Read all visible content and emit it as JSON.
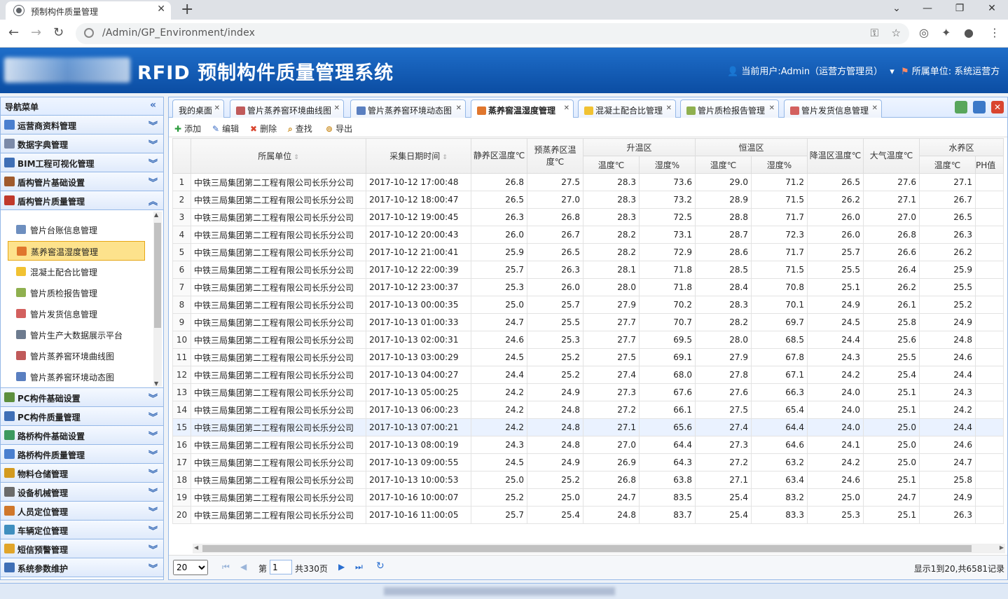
{
  "browser": {
    "tab_title": "预制构件质量管理",
    "url": "/Admin/GP_Environment/index"
  },
  "app": {
    "title": "RFID 预制构件质量管理系统",
    "current_user": "当前用户:Admin（运营方管理员）",
    "unit": "所属单位: 系统运营方"
  },
  "sidebar": {
    "header": "导航菜单",
    "groups_top": [
      {
        "label": "运营商资料管理",
        "color": "#4a7fcf"
      },
      {
        "label": "数据字典管理",
        "color": "#7c8aa8"
      },
      {
        "label": "BIM工程可视化管理",
        "color": "#3f6fb6"
      },
      {
        "label": "盾构管片基础设置",
        "color": "#a05a2c"
      },
      {
        "label": "盾构管片质量管理",
        "color": "#c0392b"
      }
    ],
    "sub_items": [
      {
        "label": "管片台账信息管理",
        "color": "#6e8fbf"
      },
      {
        "label": "蒸养窖温湿度管理",
        "color": "#e0762d"
      },
      {
        "label": "混凝土配合比管理",
        "color": "#f1c232"
      },
      {
        "label": "管片质检报告管理",
        "color": "#8fb04f"
      },
      {
        "label": "管片发货信息管理",
        "color": "#d3605e"
      },
      {
        "label": "管片生产大数据展示平台",
        "color": "#6d7b8f"
      },
      {
        "label": "管片蒸养窖环境曲线图",
        "color": "#c05a5a"
      },
      {
        "label": "管片蒸养窖环境动态图",
        "color": "#5a7fc0"
      }
    ],
    "groups_bottom": [
      {
        "label": "PC构件基础设置",
        "color": "#5d8f3d"
      },
      {
        "label": "PC构件质量管理",
        "color": "#3f6fb6"
      },
      {
        "label": "路桥构件基础设置",
        "color": "#3c9a5f"
      },
      {
        "label": "路桥构件质量管理",
        "color": "#4a7fcf"
      },
      {
        "label": "物料仓储管理",
        "color": "#d39a1f"
      },
      {
        "label": "设备机械管理",
        "color": "#6b6b6b"
      },
      {
        "label": "人员定位管理",
        "color": "#d0772a"
      },
      {
        "label": "车辆定位管理",
        "color": "#3f8fbf"
      },
      {
        "label": "短信预警管理",
        "color": "#e1a52a"
      },
      {
        "label": "系统参数维护",
        "color": "#3f6fb6"
      }
    ]
  },
  "tabs": [
    {
      "label": "我的桌面",
      "color": ""
    },
    {
      "label": "管片蒸养窖环境曲线图",
      "color": "#c05a5a"
    },
    {
      "label": "管片蒸养窖环境动态图",
      "color": "#5a7fc0"
    },
    {
      "label": "蒸养窖温湿度管理",
      "color": "#e0762d"
    },
    {
      "label": "混凝土配合比管理",
      "color": "#f1c232"
    },
    {
      "label": "管片质检报告管理",
      "color": "#8fb04f"
    },
    {
      "label": "管片发货信息管理",
      "color": "#d3605e"
    }
  ],
  "toolbar": {
    "add": "添加",
    "edit": "编辑",
    "delete": "删除",
    "search": "查找",
    "export": "导出"
  },
  "grid": {
    "headers": {
      "unit": "所属单位",
      "time": "采集日期时间",
      "static": "静养区温度℃",
      "pre": "预蒸养区温度℃",
      "rise": "升温区",
      "const": "恒温区",
      "fall": "降温区温度℃",
      "air": "大气温度℃",
      "water": "水养区",
      "temp": "温度℃",
      "hum": "湿度%",
      "ph": "PH值"
    },
    "rows": [
      {
        "n": "1",
        "unit": "中铁三局集团第二工程有限公司长乐分公司",
        "time": "2017-10-12 17:00:48",
        "v": [
          "26.8",
          "27.5",
          "28.3",
          "73.6",
          "29.0",
          "71.2",
          "26.5",
          "27.6",
          "27.1"
        ]
      },
      {
        "n": "2",
        "unit": "中铁三局集团第二工程有限公司长乐分公司",
        "time": "2017-10-12 18:00:47",
        "v": [
          "26.5",
          "27.0",
          "28.3",
          "73.2",
          "28.9",
          "71.5",
          "26.2",
          "27.1",
          "26.7"
        ]
      },
      {
        "n": "3",
        "unit": "中铁三局集团第二工程有限公司长乐分公司",
        "time": "2017-10-12 19:00:45",
        "v": [
          "26.3",
          "26.8",
          "28.3",
          "72.5",
          "28.8",
          "71.7",
          "26.0",
          "27.0",
          "26.5"
        ]
      },
      {
        "n": "4",
        "unit": "中铁三局集团第二工程有限公司长乐分公司",
        "time": "2017-10-12 20:00:43",
        "v": [
          "26.0",
          "26.7",
          "28.2",
          "73.1",
          "28.7",
          "72.3",
          "26.0",
          "26.8",
          "26.3"
        ]
      },
      {
        "n": "5",
        "unit": "中铁三局集团第二工程有限公司长乐分公司",
        "time": "2017-10-12 21:00:41",
        "v": [
          "25.9",
          "26.5",
          "28.2",
          "72.9",
          "28.6",
          "71.7",
          "25.7",
          "26.6",
          "26.2"
        ]
      },
      {
        "n": "6",
        "unit": "中铁三局集团第二工程有限公司长乐分公司",
        "time": "2017-10-12 22:00:39",
        "v": [
          "25.7",
          "26.3",
          "28.1",
          "71.8",
          "28.5",
          "71.5",
          "25.5",
          "26.4",
          "25.9"
        ]
      },
      {
        "n": "7",
        "unit": "中铁三局集团第二工程有限公司长乐分公司",
        "time": "2017-10-12 23:00:37",
        "v": [
          "25.3",
          "26.0",
          "28.0",
          "71.8",
          "28.4",
          "70.8",
          "25.1",
          "26.2",
          "25.5"
        ]
      },
      {
        "n": "8",
        "unit": "中铁三局集团第二工程有限公司长乐分公司",
        "time": "2017-10-13 00:00:35",
        "v": [
          "25.0",
          "25.7",
          "27.9",
          "70.2",
          "28.3",
          "70.1",
          "24.9",
          "26.1",
          "25.2"
        ]
      },
      {
        "n": "9",
        "unit": "中铁三局集团第二工程有限公司长乐分公司",
        "time": "2017-10-13 01:00:33",
        "v": [
          "24.7",
          "25.5",
          "27.7",
          "70.7",
          "28.2",
          "69.7",
          "24.5",
          "25.8",
          "24.9"
        ]
      },
      {
        "n": "10",
        "unit": "中铁三局集团第二工程有限公司长乐分公司",
        "time": "2017-10-13 02:00:31",
        "v": [
          "24.6",
          "25.3",
          "27.7",
          "69.5",
          "28.0",
          "68.5",
          "24.4",
          "25.6",
          "24.8"
        ]
      },
      {
        "n": "11",
        "unit": "中铁三局集团第二工程有限公司长乐分公司",
        "time": "2017-10-13 03:00:29",
        "v": [
          "24.5",
          "25.2",
          "27.5",
          "69.1",
          "27.9",
          "67.8",
          "24.3",
          "25.5",
          "24.6"
        ]
      },
      {
        "n": "12",
        "unit": "中铁三局集团第二工程有限公司长乐分公司",
        "time": "2017-10-13 04:00:27",
        "v": [
          "24.4",
          "25.2",
          "27.4",
          "68.0",
          "27.8",
          "67.1",
          "24.2",
          "25.4",
          "24.4"
        ]
      },
      {
        "n": "13",
        "unit": "中铁三局集团第二工程有限公司长乐分公司",
        "time": "2017-10-13 05:00:25",
        "v": [
          "24.2",
          "24.9",
          "27.3",
          "67.6",
          "27.6",
          "66.3",
          "24.0",
          "25.1",
          "24.3"
        ]
      },
      {
        "n": "14",
        "unit": "中铁三局集团第二工程有限公司长乐分公司",
        "time": "2017-10-13 06:00:23",
        "v": [
          "24.2",
          "24.8",
          "27.2",
          "66.1",
          "27.5",
          "65.4",
          "24.0",
          "25.1",
          "24.2"
        ]
      },
      {
        "n": "15",
        "unit": "中铁三局集团第二工程有限公司长乐分公司",
        "time": "2017-10-13 07:00:21",
        "v": [
          "24.2",
          "24.8",
          "27.1",
          "65.6",
          "27.4",
          "64.4",
          "24.0",
          "25.0",
          "24.4"
        ]
      },
      {
        "n": "16",
        "unit": "中铁三局集团第二工程有限公司长乐分公司",
        "time": "2017-10-13 08:00:19",
        "v": [
          "24.3",
          "24.8",
          "27.0",
          "64.4",
          "27.3",
          "64.6",
          "24.1",
          "25.0",
          "24.6"
        ]
      },
      {
        "n": "17",
        "unit": "中铁三局集团第二工程有限公司长乐分公司",
        "time": "2017-10-13 09:00:55",
        "v": [
          "24.5",
          "24.9",
          "26.9",
          "64.3",
          "27.2",
          "63.2",
          "24.2",
          "25.0",
          "24.7"
        ]
      },
      {
        "n": "18",
        "unit": "中铁三局集团第二工程有限公司长乐分公司",
        "time": "2017-10-13 10:00:53",
        "v": [
          "25.0",
          "25.2",
          "26.8",
          "63.8",
          "27.1",
          "63.4",
          "24.6",
          "25.1",
          "25.8"
        ]
      },
      {
        "n": "19",
        "unit": "中铁三局集团第二工程有限公司长乐分公司",
        "time": "2017-10-16 10:00:07",
        "v": [
          "25.2",
          "25.0",
          "24.7",
          "83.5",
          "25.4",
          "83.2",
          "25.0",
          "24.7",
          "24.9"
        ]
      },
      {
        "n": "20",
        "unit": "中铁三局集团第二工程有限公司长乐分公司",
        "time": "2017-10-16 11:00:05",
        "v": [
          "25.7",
          "25.4",
          "24.8",
          "83.7",
          "25.4",
          "83.3",
          "25.3",
          "25.1",
          "26.3"
        ]
      }
    ],
    "highlight_row": 15
  },
  "pager": {
    "page_size": "20",
    "page_prefix": "第",
    "page_value": "1",
    "page_total": "共330页",
    "info": "显示1到20,共6581记录"
  }
}
